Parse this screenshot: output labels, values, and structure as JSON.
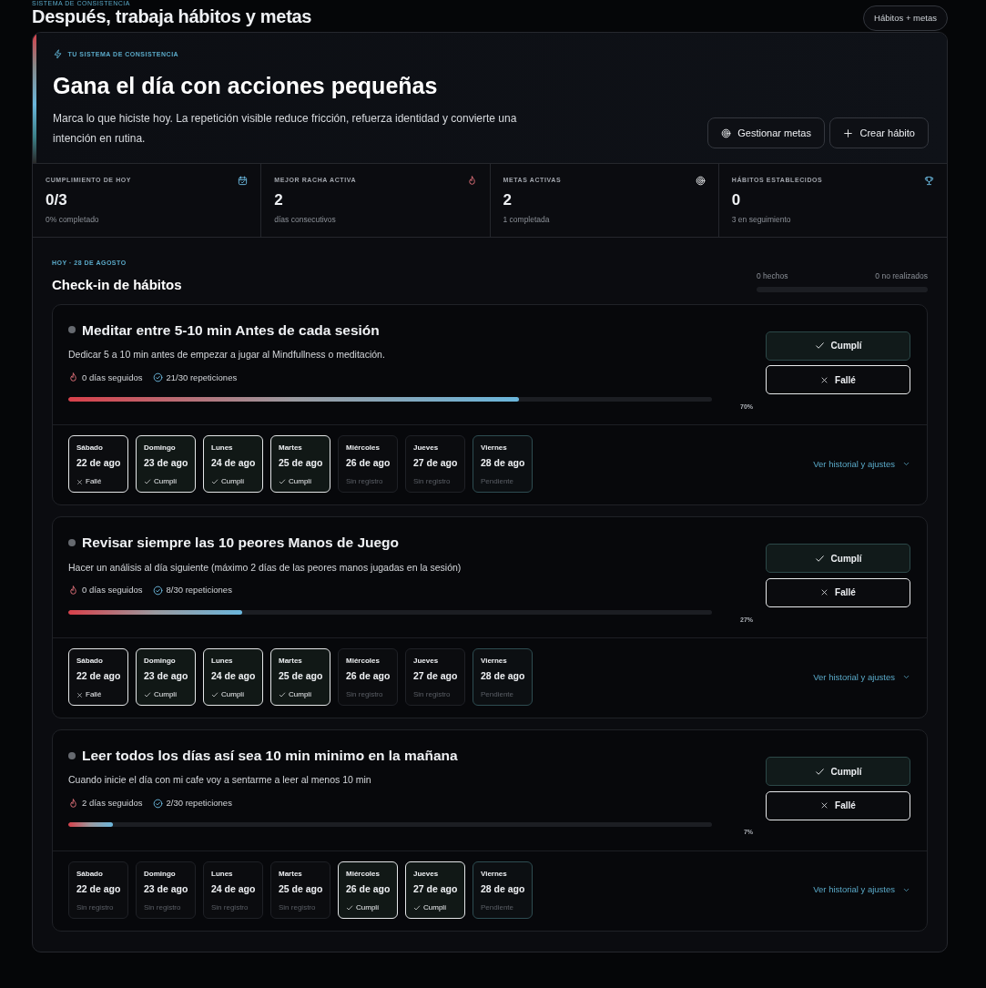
{
  "header": {
    "eyebrow": "SISTEMA DE CONSISTENCIA",
    "title": "Después, trabaja hábitos y metas",
    "pill": "Hábitos + metas"
  },
  "hero": {
    "eyebrow": "TU SISTEMA DE CONSISTENCIA",
    "title": "Gana el día con acciones pequeñas",
    "text": "Marca lo que hiciste hoy. La repetición visible reduce fricción, refuerza identidad y convierte una intención en rutina.",
    "buttons": [
      {
        "kind": "target",
        "label": "Gestionar metas"
      },
      {
        "kind": "plus",
        "label": "Crear hábito"
      }
    ]
  },
  "stats": [
    {
      "kind": "calendar",
      "label": "CUMPLIMIENTO DE HOY",
      "value": "0/3",
      "note": "0% completado"
    },
    {
      "kind": "flame",
      "label": "MEJOR RACHA ACTIVA",
      "value": "2",
      "note": "días consecutivos"
    },
    {
      "kind": "target",
      "label": "METAS ACTIVAS",
      "value": "2",
      "note": "1 completada"
    },
    {
      "kind": "trophy",
      "label": "HÁBITOS ESTABLECIDOS",
      "value": "0",
      "note": "3 en seguimiento"
    }
  ],
  "checkin": {
    "eyebrow": "HOY · 28 DE AGOSTO",
    "title": "Check-in de hábitos",
    "done_label": "0 hechos",
    "missed_label": "0 no realizados"
  },
  "habits": [
    {
      "title": "Meditar entre 5-10 min Antes de cada sesión",
      "description": "Dedicar 5 a 10 min antes de empezar a jugar al Mindfullness o meditación.",
      "streak": "0 días seguidos",
      "reps": "21/30 repeticiones",
      "level": 0.7,
      "percent": "70%",
      "done_button": "Cumplí",
      "fail_button": "Fallé",
      "link": "Ver historial y ajustes",
      "days": [
        {
          "day": "Sábado",
          "date": "22 de ago",
          "kind": "failed",
          "status": "Fallé"
        },
        {
          "day": "Domingo",
          "date": "23 de ago",
          "kind": "done",
          "status": "Cumplí"
        },
        {
          "day": "Lunes",
          "date": "24 de ago",
          "kind": "done",
          "status": "Cumplí"
        },
        {
          "day": "Martes",
          "date": "25 de ago",
          "kind": "done",
          "status": "Cumplí"
        },
        {
          "day": "Miércoles",
          "date": "26 de ago",
          "kind": "empty",
          "status": "Sin registro"
        },
        {
          "day": "Jueves",
          "date": "27 de ago",
          "kind": "empty",
          "status": "Sin registro"
        },
        {
          "day": "Viernes",
          "date": "28 de ago",
          "kind": "pending",
          "status": "Pendiente"
        }
      ]
    },
    {
      "title": "Revisar siempre las 10 peores Manos de Juego",
      "description": "Hacer un análisis al día siguiente (máximo 2 días de las peores manos jugadas en la sesión)",
      "streak": "0 días seguidos",
      "reps": "8/30 repeticiones",
      "level": 0.27,
      "percent": "27%",
      "done_button": "Cumplí",
      "fail_button": "Fallé",
      "link": "Ver historial y ajustes",
      "days": [
        {
          "day": "Sábado",
          "date": "22 de ago",
          "kind": "failed",
          "status": "Fallé"
        },
        {
          "day": "Domingo",
          "date": "23 de ago",
          "kind": "done",
          "status": "Cumplí"
        },
        {
          "day": "Lunes",
          "date": "24 de ago",
          "kind": "done",
          "status": "Cumplí"
        },
        {
          "day": "Martes",
          "date": "25 de ago",
          "kind": "done",
          "status": "Cumplí"
        },
        {
          "day": "Miércoles",
          "date": "26 de ago",
          "kind": "empty",
          "status": "Sin registro"
        },
        {
          "day": "Jueves",
          "date": "27 de ago",
          "kind": "empty",
          "status": "Sin registro"
        },
        {
          "day": "Viernes",
          "date": "28 de ago",
          "kind": "pending",
          "status": "Pendiente"
        }
      ]
    },
    {
      "title": "Leer todos los días así sea 10 min minimo en la mañana",
      "description": "Cuando inicie el día con mi cafe voy a sentarme a leer al menos 10 min",
      "streak": "2 días seguidos",
      "reps": "2/30 repeticiones",
      "level": 0.07,
      "percent": "7%",
      "done_button": "Cumplí",
      "fail_button": "Fallé",
      "link": "Ver historial y ajustes",
      "days": [
        {
          "day": "Sábado",
          "date": "22 de ago",
          "kind": "empty",
          "status": "Sin registro"
        },
        {
          "day": "Domingo",
          "date": "23 de ago",
          "kind": "empty",
          "status": "Sin registro"
        },
        {
          "day": "Lunes",
          "date": "24 de ago",
          "kind": "empty",
          "status": "Sin registro"
        },
        {
          "day": "Martes",
          "date": "25 de ago",
          "kind": "empty",
          "status": "Sin registro"
        },
        {
          "day": "Miércoles",
          "date": "26 de ago",
          "kind": "done",
          "status": "Cumplí"
        },
        {
          "day": "Jueves",
          "date": "27 de ago",
          "kind": "done",
          "status": "Cumplí"
        },
        {
          "day": "Viernes",
          "date": "28 de ago",
          "kind": "pending",
          "status": "Pendiente"
        }
      ]
    }
  ]
}
